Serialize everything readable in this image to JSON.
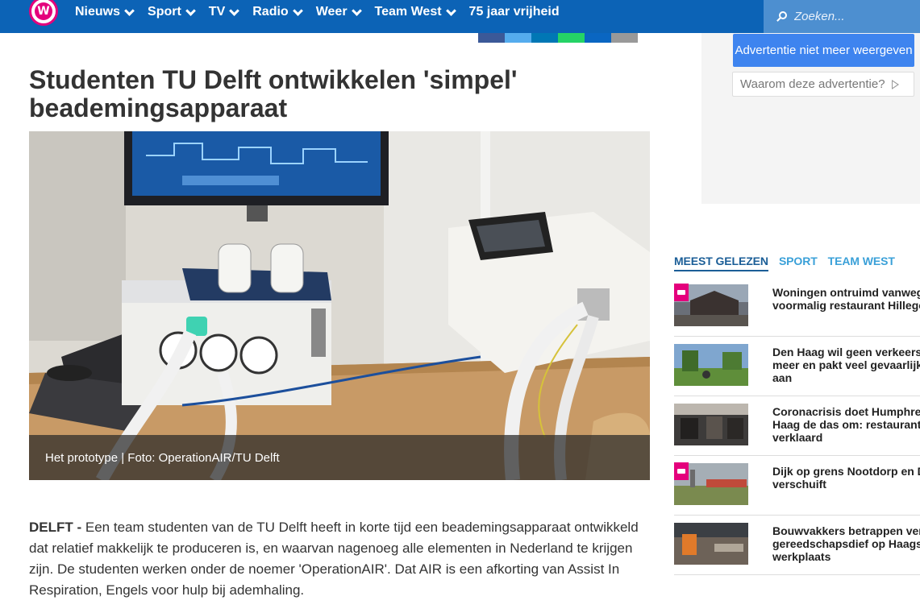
{
  "header": {
    "logo_letter": "W",
    "nav": [
      {
        "label": "Nieuws",
        "has_dropdown": true
      },
      {
        "label": "Sport",
        "has_dropdown": true
      },
      {
        "label": "TV",
        "has_dropdown": true
      },
      {
        "label": "Radio",
        "has_dropdown": true
      },
      {
        "label": "Weer",
        "has_dropdown": true
      },
      {
        "label": "Team West",
        "has_dropdown": true
      },
      {
        "label": "75 jaar vrijheid",
        "has_dropdown": false
      }
    ],
    "search_placeholder": "Zoeken..."
  },
  "share_colors": [
    "#3b5998",
    "#55acee",
    "#0077b5",
    "#25d366",
    "#0a66c2",
    "#999999"
  ],
  "article": {
    "title": "Studenten TU Delft ontwikkelen 'simpel' beademingsapparaat",
    "photo_caption": "Het prototype | Foto: OperationAIR/TU Delft",
    "dateline": "DELFT - ",
    "intro": "Een team studenten van de TU Delft heeft in korte tijd een beademingsapparaat ontwikkeld dat relatief makkelijk te produceren is, en waarvan nagenoeg alle elementen in Nederland te krijgen zijn. De studenten werken onder de noemer 'OperationAIR'. Dat AIR is een afkorting van Assist In Respiration, Engels voor hulp bij ademhaling."
  },
  "ad": {
    "stop_label": "Advertentie niet meer weergeven",
    "why_label": "Waarom deze advertentie?"
  },
  "sidebar": {
    "tabs": [
      {
        "label": "MEEST GELEZEN",
        "active": true
      },
      {
        "label": "SPORT",
        "active": false
      },
      {
        "label": "TEAM WEST",
        "active": false
      }
    ],
    "items": [
      {
        "title_lines": [
          "Woningen ontruimd vanweg",
          "voormalig restaurant Hillego"
        ],
        "video": true
      },
      {
        "title_lines": [
          "Den Haag wil geen verkeers",
          "meer en pakt veel gevaarlijk",
          "aan"
        ],
        "video": false
      },
      {
        "title_lines": [
          "Coronacrisis doet Humphrey",
          "Haag de das om: restaurant",
          "verklaard"
        ],
        "video": false
      },
      {
        "title_lines": [
          "Dijk op grens Nootdorp en D",
          "verschuift"
        ],
        "video": true
      },
      {
        "title_lines": [
          "Bouwvakkers betrappen ver",
          "gereedschapsdief op Haagse",
          "werkplaats"
        ],
        "video": false
      }
    ]
  },
  "colors": {
    "nav_bg": "#0c63b6",
    "search_bg": "#4d8fd0",
    "brand_pink": "#e4007c",
    "tab_active": "#1b5e97",
    "tab_inactive": "#3aa0d8",
    "ad_button": "#3e84ef"
  }
}
